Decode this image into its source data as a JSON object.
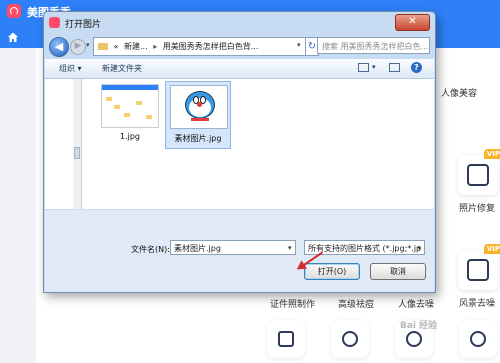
{
  "app": {
    "name": "美图秀秀",
    "brand_color": "#2e80f8",
    "side_labels": [
      "人像美容",
      "照片修复",
      "风景去噪"
    ],
    "tool_labels": [
      "证件照制作",
      "高级祛痘",
      "人像去噪"
    ],
    "vip_badge": "VIP"
  },
  "dialog": {
    "title": "打开图片",
    "close_glyph": "✕",
    "breadcrumb": [
      "«",
      "新建...",
      "用美图秀秀怎样把白色背..."
    ],
    "search_placeholder": "搜索 用美图秀秀怎样把白色...",
    "toolbar": {
      "organize": "组织 ▾",
      "new_folder": "新建文件夹"
    },
    "files": [
      {
        "name": "1.jpg",
        "selected": false
      },
      {
        "name": "素材图片.jpg",
        "selected": true
      }
    ],
    "filename_label": "文件名(N):",
    "filename_value": "素材图片.jpg",
    "filetype_value": "所有支持的图片格式 (*.jpg;*.jp",
    "open_button": "打开(O)",
    "cancel_button": "取消"
  },
  "watermark": "Bai 经验"
}
